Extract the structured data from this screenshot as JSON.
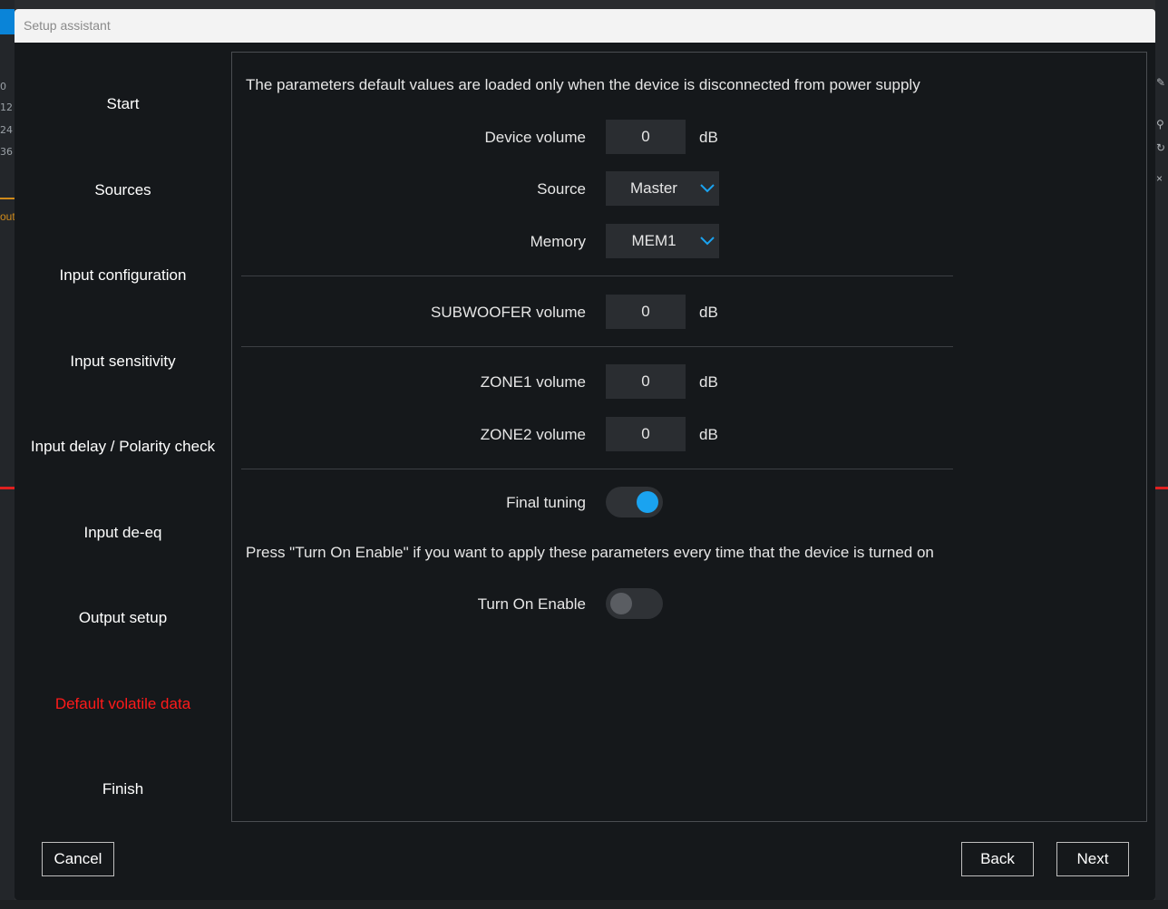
{
  "background": {
    "ticks": [
      "0",
      "12",
      "24",
      "36"
    ],
    "out_label": "out",
    "right_icons": [
      "✎",
      "⚲",
      "↻",
      "×"
    ]
  },
  "dialog": {
    "title": "Setup assistant",
    "steps": [
      {
        "label": "Start"
      },
      {
        "label": "Sources"
      },
      {
        "label": "Input configuration"
      },
      {
        "label": "Input sensitivity"
      },
      {
        "label": "Input delay / Polarity check"
      },
      {
        "label": "Input de-eq"
      },
      {
        "label": "Output setup"
      },
      {
        "label": "Default volatile data",
        "active": true
      },
      {
        "label": "Finish"
      }
    ],
    "notice": "The parameters default values are loaded only when the device is disconnected from power supply",
    "device_volume": {
      "label": "Device volume",
      "value": "0",
      "unit": "dB"
    },
    "source": {
      "label": "Source",
      "value": "Master"
    },
    "memory": {
      "label": "Memory",
      "value": "MEM1"
    },
    "subwoofer_volume": {
      "label": "SUBWOOFER volume",
      "value": "0",
      "unit": "dB"
    },
    "zone1_volume": {
      "label": "ZONE1 volume",
      "value": "0",
      "unit": "dB"
    },
    "zone2_volume": {
      "label": "ZONE2 volume",
      "value": "0",
      "unit": "dB"
    },
    "final_tuning": {
      "label": "Final tuning",
      "on": true
    },
    "hint": "Press \"Turn On Enable\" if you want to apply these parameters every time that the device is turned on",
    "turn_on_enable": {
      "label": "Turn On Enable",
      "on": false
    },
    "buttons": {
      "cancel": "Cancel",
      "back": "Back",
      "next": "Next"
    },
    "colors": {
      "accent": "#1aa3f0",
      "active_step": "#ff1a1a"
    }
  }
}
